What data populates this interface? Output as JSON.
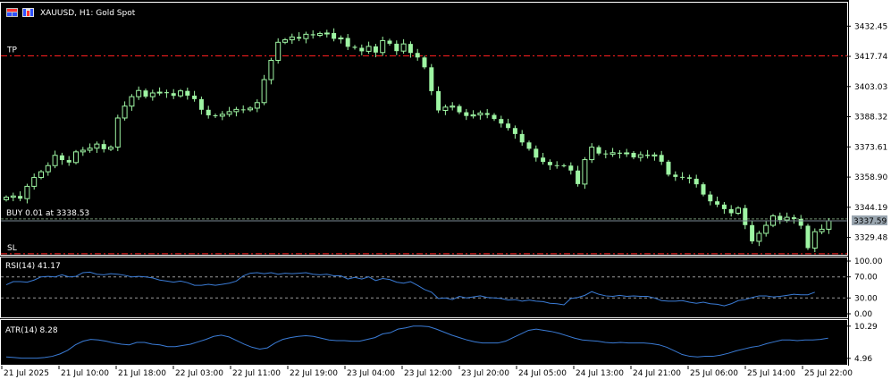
{
  "window": {
    "symbol_title": "XAUUSD, H1:  Gold Spot"
  },
  "colors": {
    "background": "#000000",
    "frame": "#ffffff",
    "candle": "#9ef5a3",
    "level_line": "#ff2020",
    "entry_line": "#6f8f6f",
    "price_badge": "#9aa6b0",
    "indicator_line": "#3a7bd5",
    "axis_panel": "#ffffff"
  },
  "icons": [
    "grid-toolbar-icon",
    "chart-type-icon"
  ],
  "price_axis": {
    "ticks": [
      "3432.45",
      "3417.74",
      "3403.03",
      "3388.32",
      "3373.61",
      "3358.90",
      "3344.19",
      "3329.48"
    ],
    "current_price": "3337.59",
    "ylim": [
      3320.6,
      3443.9
    ]
  },
  "levels": {
    "tp_label": "TP",
    "tp_price": 3418.0,
    "entry_label": "BUY 0.01 at 3338.53",
    "entry_price": 3338.53,
    "sl_label": "SL",
    "sl_price": 3321.5
  },
  "rsi": {
    "label": "RSI(14) 41.17",
    "ticks": [
      "100.00",
      "70.00",
      "30.00",
      "0.00"
    ],
    "levels": [
      70,
      30
    ],
    "ylim": [
      0,
      100
    ]
  },
  "atr": {
    "label": "ATR(14) 8.28",
    "ticks": [
      "10.29",
      "4.96"
    ],
    "ylim": [
      4.2,
      11.0
    ]
  },
  "time_axis": {
    "labels": [
      "21 Jul 2025",
      "21 Jul 10:00",
      "21 Jul 18:00",
      "22 Jul 03:00",
      "22 Jul 11:00",
      "22 Jul 19:00",
      "23 Jul 04:00",
      "23 Jul 12:00",
      "23 Jul 20:00",
      "24 Jul 05:00",
      "24 Jul 13:00",
      "24 Jul 21:00",
      "25 Jul 06:00",
      "25 Jul 14:00",
      "25 Jul 22:00"
    ]
  },
  "chart_data": {
    "type": "candlestick",
    "series": [
      {
        "name": "XAUUSD H1",
        "close": [
          3349.1,
          3349.7,
          3348.4,
          3354.4,
          3358.7,
          3361.5,
          3364.5,
          3369.5,
          3367.2,
          3366.0,
          3371.2,
          3372.0,
          3373.0,
          3375.0,
          3372.5,
          3373.5,
          3387.7,
          3393.5,
          3398.1,
          3401.1,
          3398.1,
          3399.9,
          3400.3,
          3399.8,
          3398.5,
          3400.9,
          3398.6,
          3396.9,
          3391.7,
          3389.0,
          3388.6,
          3389.5,
          3390.8,
          3391.9,
          3391.7,
          3392.5,
          3395.2,
          3406.4,
          3415.8,
          3424.6,
          3425.8,
          3427.2,
          3426.4,
          3428.5,
          3428.0,
          3428.9,
          3429.1,
          3426.3,
          3426.7,
          3422.4,
          3421.9,
          3420.2,
          3422.6,
          3419.6,
          3425.4,
          3423.9,
          3420.3,
          3423.8,
          3419.4,
          3417.2,
          3412.4,
          3400.8,
          3391.4,
          3393.0,
          3393.5,
          3390.5,
          3388.7,
          3389.2,
          3390.1,
          3389.2,
          3387.2,
          3385.0,
          3382.8,
          3379.9,
          3375.8,
          3372.7,
          3368.4,
          3366.3,
          3364.7,
          3364.6,
          3364.5,
          3362.1,
          3355.5,
          3367.4,
          3373.5,
          3370.4,
          3370.0,
          3370.8,
          3370.3,
          3370.7,
          3368.5,
          3369.8,
          3369.2,
          3369.7,
          3366.4,
          3360.1,
          3359.0,
          3358.8,
          3358.1,
          3355.4,
          3350.4,
          3347.1,
          3345.5,
          3343.3,
          3341.3,
          3343.8,
          3335.5,
          3327.6,
          3331.5,
          3335.4,
          3340.0,
          3338.0,
          3339.3,
          3338.5,
          3335.2,
          3324.3,
          3332.3,
          3333.5,
          3337.6
        ]
      },
      {
        "name": "RSI(14)",
        "values": [
          55,
          61,
          61,
          60,
          64,
          70,
          71,
          70,
          74,
          70,
          71,
          78,
          79,
          75,
          74,
          76,
          75,
          73,
          70,
          71,
          70,
          68,
          64,
          62,
          60,
          62,
          59,
          54,
          54,
          56,
          54,
          56,
          58,
          62,
          72,
          77,
          78,
          76,
          78,
          75,
          77,
          76,
          77,
          78,
          75,
          74,
          75,
          72,
          72,
          66,
          69,
          66,
          70,
          63,
          67,
          65,
          60,
          58,
          61,
          54,
          46,
          41,
          29,
          30,
          27,
          33,
          30,
          32,
          34,
          31,
          30,
          29,
          26,
          27,
          24,
          26,
          24,
          23,
          20,
          19,
          17,
          29,
          31,
          35,
          42,
          37,
          34,
          33,
          35,
          33,
          34,
          33,
          33,
          30,
          25,
          24,
          24,
          25,
          22,
          20,
          22,
          19,
          18,
          15,
          19,
          25,
          27,
          31,
          34,
          34,
          32,
          33,
          35,
          37,
          36,
          36,
          41
        ]
      },
      {
        "name": "ATR(14)",
        "values": [
          5.2,
          5.1,
          5.0,
          5.0,
          5.0,
          5.1,
          5.3,
          5.7,
          6.3,
          7.2,
          7.8,
          8.1,
          8.0,
          7.8,
          7.5,
          7.3,
          7.2,
          7.6,
          7.6,
          7.3,
          7.2,
          6.9,
          6.9,
          7.1,
          7.3,
          7.7,
          8.1,
          8.6,
          8.8,
          8.5,
          7.9,
          7.3,
          6.8,
          6.5,
          6.7,
          7.5,
          8.1,
          8.4,
          8.6,
          8.7,
          8.6,
          8.3,
          8.0,
          7.9,
          7.9,
          7.8,
          7.8,
          8.1,
          8.4,
          9.0,
          9.2,
          9.8,
          10.0,
          10.3,
          10.3,
          10.2,
          9.8,
          9.3,
          8.8,
          8.4,
          8.0,
          7.7,
          7.5,
          7.5,
          7.5,
          7.8,
          8.4,
          9.0,
          9.6,
          9.8,
          9.6,
          9.4,
          9.1,
          8.7,
          8.3,
          8.0,
          7.9,
          7.8,
          7.6,
          7.5,
          7.6,
          7.5,
          7.5,
          7.5,
          7.4,
          7.2,
          6.8,
          6.2,
          5.6,
          5.3,
          5.2,
          5.3,
          5.3,
          5.5,
          5.8,
          6.2,
          6.5,
          6.8,
          7.0,
          7.4,
          7.7,
          8.0,
          8.0,
          7.9,
          8.0,
          8.0,
          8.1,
          8.3
        ]
      }
    ],
    "candle_width_note": "hourly candles"
  }
}
